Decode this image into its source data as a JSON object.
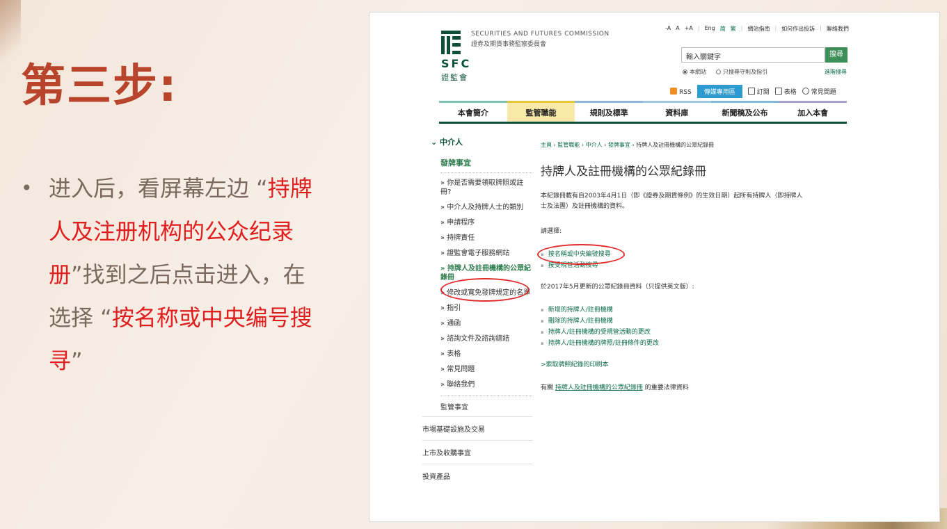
{
  "slide": {
    "title": "第三步:",
    "bullet_marker": "•",
    "bullet": {
      "p1": "进入后，看屏幕左边 “",
      "r1": "持牌人及注册机构的公众纪录册",
      "p2": "”找到之后点击进入，在选择 “",
      "r2": "按名称或中央编号搜寻",
      "p3": "”"
    }
  },
  "site": {
    "org_en": "SECURITIES AND FUTURES COMMISSION",
    "org_cn": "證券及期貨事務監察委員會",
    "logo_sfc": "SFC",
    "logo_cn": "證監會",
    "toplinks": {
      "font_small": "-A",
      "font_normal": "A",
      "font_large": "+A",
      "eng": "Eng",
      "simp": "简",
      "trad": "繁",
      "sitemap": "網站指南",
      "complaint": "如何作出投訴",
      "contact": "聯絡我們"
    },
    "search": {
      "placeholder": "輸入關鍵字",
      "button": "搜尋",
      "opt_site": "本網站",
      "opt_register": "只搜尋守則及指引",
      "advanced": "進階搜尋"
    },
    "util": {
      "rss": "RSS",
      "media": "傳媒專用區",
      "subscribe": "訂閱",
      "forms": "表格",
      "faq": "常見問題"
    },
    "nav": [
      {
        "label": "本會簡介",
        "color": "#7ac2b5"
      },
      {
        "label": "監管職能",
        "color": "#e8c53a"
      },
      {
        "label": "規則及標準",
        "color": "#8fb5d9"
      },
      {
        "label": "資料庫",
        "color": "#9fc7e3"
      },
      {
        "label": "新聞稿及公布",
        "color": "#7fb8d8"
      },
      {
        "label": "加入本會",
        "color": "#a9a0cf"
      }
    ]
  },
  "sidenav": {
    "head": "中介人",
    "sub": "發牌事宜",
    "items": [
      "» 你是否需要領取牌照或註冊?",
      "» 中介人及持牌人士的類別",
      "» 申請程序",
      "» 持牌責任",
      "» 證監會電子服務網站",
      "» 持牌人及註冊機構的公眾紀錄冊",
      "» 修改或寬免發牌規定的名單",
      "» 指引",
      "» 通函",
      "» 諮詢文件及諮詢總結",
      "» 表格",
      "» 常見問題",
      "» 聯絡我們"
    ],
    "supervision": "監管事宜",
    "mains": [
      "市場基礎設施及交易",
      "上市及收購事宜",
      "投資產品"
    ]
  },
  "content": {
    "crumbs": [
      "主頁",
      "監管職能",
      "中介人",
      "發牌事宜"
    ],
    "crumb_current": "持牌人及註冊機構的公眾紀錄冊",
    "crumb_sep": "›",
    "heading": "持牌人及註冊機構的公眾紀錄冊",
    "intro": "本紀錄冊載有自2003年4月1日（即《證券及期貨條例》的生效日期）起所有持牌人（即持牌人士及法團）及註冊機構的資料。",
    "choose": "請選擇:",
    "links1": [
      "按名稱或中央編號搜尋",
      "按受規管活動搜尋"
    ],
    "update": "於2017年5月更新的公眾紀錄冊資料（只提供英文版）:",
    "links2": [
      "新增的持牌人/註冊機構",
      "刪除的持牌人/註冊機構",
      "持牌人/註冊機構的受規管活動的更改",
      "持牌人/註冊機構的牌照/註冊條件的更改"
    ],
    "print": ">索取牌照紀錄的印刷本",
    "legal_pre": "有關 ",
    "legal_link": "持牌人及註冊機構的公眾紀錄冊",
    "legal_post": " 的重要法律資料"
  }
}
